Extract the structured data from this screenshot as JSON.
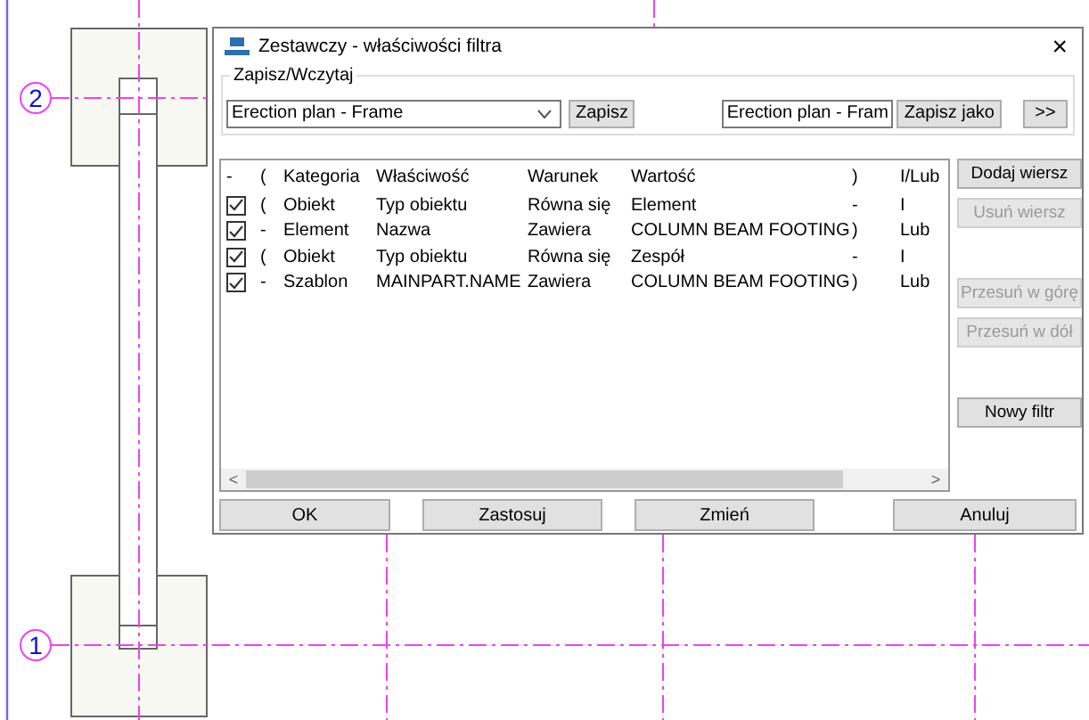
{
  "grid_labels": [
    "2",
    "1"
  ],
  "dialog": {
    "title": "Zestawczy - właściwości filtra",
    "close": "×",
    "save_load": {
      "legend": "Zapisz/Wczytaj",
      "preset": "Erection plan - Frame",
      "save": "Zapisz",
      "save_as_name": "Erection plan - Fram",
      "save_as": "Zapisz jako",
      "more": ">>"
    },
    "table": {
      "columns": [
        "-",
        "(",
        "Kategoria",
        "Właściwość",
        "Warunek",
        "Wartość",
        ")",
        "I/Lub"
      ],
      "rows": [
        {
          "checked": true,
          "open": "(",
          "category": "Obiekt",
          "property": "Typ obiektu",
          "condition": "Równa się",
          "value": "Element",
          "close": "-",
          "and_or": "I"
        },
        {
          "checked": true,
          "open": "-",
          "category": "Element",
          "property": "Nazwa",
          "condition": "Zawiera",
          "value": "COLUMN BEAM FOOTING",
          "close": ")",
          "and_or": "Lub"
        },
        {
          "checked": true,
          "open": "(",
          "category": "Obiekt",
          "property": "Typ obiektu",
          "condition": "Równa się",
          "value": "Zespół",
          "close": "-",
          "and_or": "I"
        },
        {
          "checked": true,
          "open": "-",
          "category": "Szablon",
          "property": "MAINPART.NAME",
          "condition": "Zawiera",
          "value": "COLUMN BEAM FOOTING",
          "close": ")",
          "and_or": "Lub"
        }
      ],
      "scroll_left": "<",
      "scroll_right": ">"
    },
    "side_buttons": [
      {
        "label": "Dodaj wiersz",
        "disabled": false
      },
      {
        "label": "Usuń wiersz",
        "disabled": true
      },
      {
        "label": "Przesuń w górę",
        "disabled": true
      },
      {
        "label": "Przesuń w dół",
        "disabled": true
      },
      {
        "label": "Nowy filtr",
        "disabled": false
      }
    ],
    "bottom_buttons": [
      "OK",
      "Zastosuj",
      "Zmień",
      "Anuluj"
    ]
  }
}
